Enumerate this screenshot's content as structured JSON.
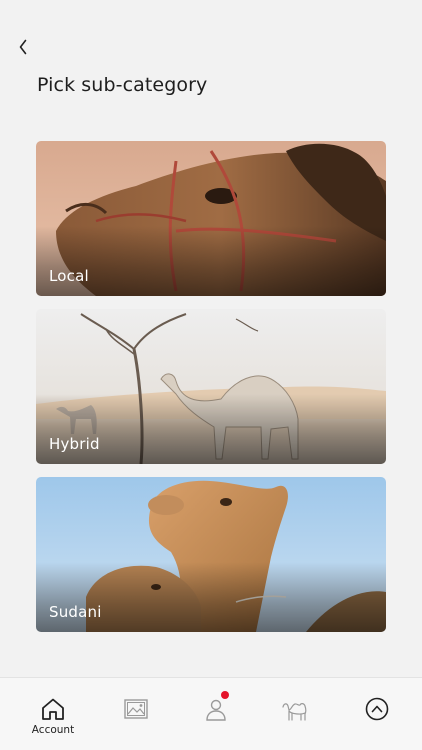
{
  "header": {
    "title": "Pick sub-category"
  },
  "categories": [
    {
      "label": "Local"
    },
    {
      "label": "Hybrid"
    },
    {
      "label": "Sudani"
    }
  ],
  "tabbar": {
    "account_label": "Account",
    "notification_badge_color": "#e4142b"
  },
  "colors": {
    "background": "#f2f2f2",
    "title": "#1e1e1e",
    "icon_active": "#222222",
    "icon_inactive": "#9a9a9a"
  }
}
